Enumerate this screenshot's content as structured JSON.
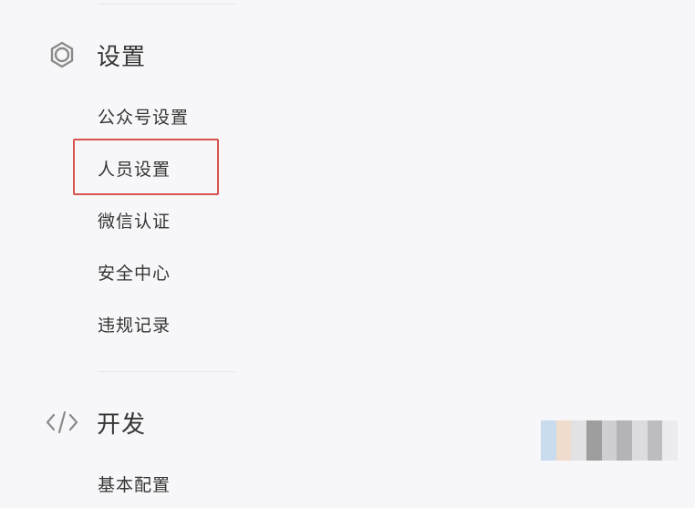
{
  "settings": {
    "title": "设置",
    "icon": "gear-icon",
    "items": [
      {
        "label": "公众号设置"
      },
      {
        "label": "人员设置",
        "highlighted": true
      },
      {
        "label": "微信认证"
      },
      {
        "label": "安全中心"
      },
      {
        "label": "违规记录"
      }
    ]
  },
  "develop": {
    "title": "开发",
    "icon": "code-icon",
    "items": [
      {
        "label": "基本配置"
      }
    ]
  },
  "colors": {
    "background": "#f7f7f9",
    "text": "#353535",
    "icon": "#8a8a8a",
    "divider": "#e4e6eb",
    "highlight_border": "#d9534f"
  }
}
